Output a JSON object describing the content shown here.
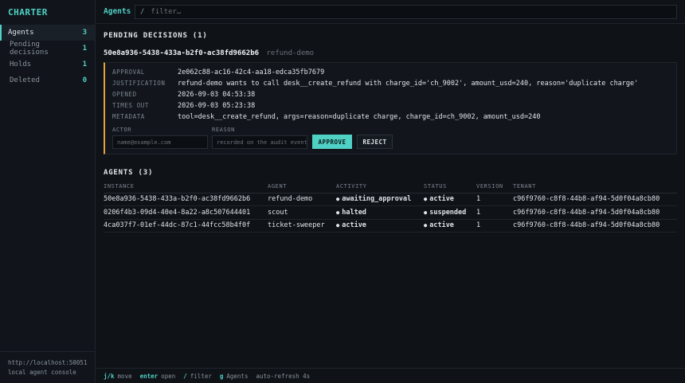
{
  "sidebar": {
    "brand": "CHARTER",
    "items": [
      {
        "label": "Agents",
        "count": "3"
      },
      {
        "label": "Pending decisions",
        "count": "1"
      },
      {
        "label": "Holds",
        "count": "1"
      },
      {
        "label": "Deleted",
        "count": "0"
      }
    ],
    "footer": {
      "url": "http://localhost:50051",
      "caption": "local agent console"
    }
  },
  "header": {
    "title": "Agents",
    "filter_prefix": "/",
    "filter_placeholder": "filter…"
  },
  "pending": {
    "title": "PENDING DECISIONS (1)",
    "decision": {
      "id": "50e8a936-5438-433a-b2f0-ac38fd9662b6",
      "agent": "refund-demo",
      "fields": [
        {
          "key": "APPROVAL",
          "value": "2e062c88-ac16-42c4-aa18-edca35fb7679"
        },
        {
          "key": "JUSTIFICATION",
          "value": "refund-demo wants to call desk__create_refund with charge_id='ch_9002', amount_usd=240, reason='duplicate charge'"
        },
        {
          "key": "OPENED",
          "value": "2026-09-03 04:53:38"
        },
        {
          "key": "TIMES OUT",
          "value": "2026-09-03 05:23:38"
        },
        {
          "key": "METADATA",
          "value": "tool=desk__create_refund, args=reason=duplicate charge, charge_id=ch_9002, amount_usd=240"
        }
      ],
      "actor_label": "ACTOR",
      "actor_placeholder": "name@example.com",
      "reason_label": "REASON",
      "reason_placeholder": "recorded on the audit event",
      "approve_label": "APPROVE",
      "reject_label": "REJECT"
    }
  },
  "agents": {
    "title": "AGENTS (3)",
    "columns": [
      "INSTANCE",
      "AGENT",
      "ACTIVITY",
      "STATUS",
      "VERSION",
      "TENANT"
    ],
    "rows": [
      {
        "instance": "50e8a936-5438-433a-b2f0-ac38fd9662b6",
        "agent": "refund-demo",
        "activity": "awaiting_approval",
        "activity_color": "#f0b429",
        "status": "active",
        "status_color": "#48bb78",
        "version": "1",
        "tenant": "c96f9760-c8f8-44b8-af94-5d0f04a8cb80"
      },
      {
        "instance": "0206f4b3-09d4-40e4-8a22-a8c507644401",
        "agent": "scout",
        "activity": "halted",
        "activity_color": "#f56565",
        "status": "suspended",
        "status_color": "#f0b429",
        "version": "1",
        "tenant": "c96f9760-c8f8-44b8-af94-5d0f04a8cb80"
      },
      {
        "instance": "4ca037f7-01ef-44dc-87c1-44fcc58b4f0f",
        "agent": "ticket-sweeper",
        "activity": "active",
        "activity_color": "#48bb78",
        "status": "active",
        "status_color": "#48bb78",
        "version": "1",
        "tenant": "c96f9760-c8f8-44b8-af94-5d0f04a8cb80"
      }
    ]
  },
  "statusbar": {
    "hints": [
      {
        "key": "j/k",
        "label": "move"
      },
      {
        "key": "enter",
        "label": "open"
      },
      {
        "key": "/",
        "label": "filter"
      },
      {
        "key": "g",
        "label": "Agents"
      }
    ],
    "refresh": "auto-refresh 4s"
  },
  "colors": {
    "accent": "#4fd1c5",
    "warning": "#f0b429",
    "danger": "#f56565",
    "success": "#48bb78"
  }
}
